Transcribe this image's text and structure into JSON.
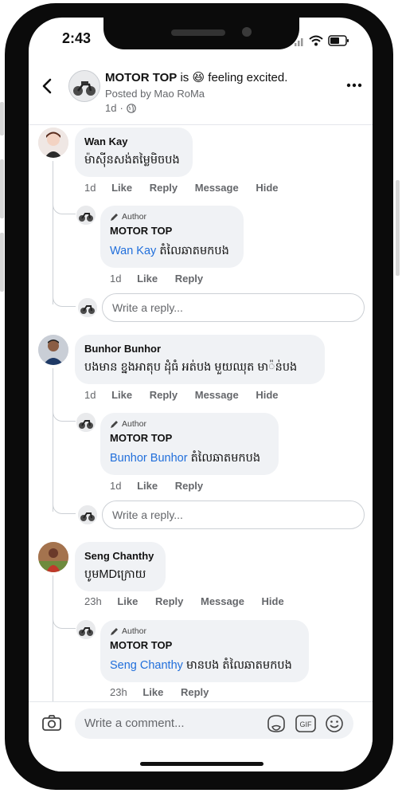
{
  "status_bar": {
    "time": "2:43"
  },
  "header": {
    "page_name": "MOTOR TOP",
    "status_prefix": "is",
    "status_emoji": "😆",
    "status_suffix": "feeling excited.",
    "posted_by": "Posted by Mao RoMa",
    "time": "1d"
  },
  "comments": [
    {
      "author": "Wan Kay",
      "text": "ម៉ាស៊ីនសង់តម្លៃមិចបង",
      "time": "1d",
      "actions": [
        "Like",
        "Reply",
        "Message",
        "Hide"
      ],
      "reply": {
        "badge": "Author",
        "author": "MOTOR TOP",
        "mention": "Wan Kay",
        "text": "តំលៃឆាតមកបង",
        "time": "1d",
        "actions": [
          "Like",
          "Reply"
        ]
      },
      "reply_placeholder": "Write a reply..."
    },
    {
      "author": "Bunhor Bunhor",
      "text": "បងមាន ខ្នងអាតុប ដំុធំ អត់បង មួយឈុត   មា៉ន់បង",
      "time": "1d",
      "actions": [
        "Like",
        "Reply",
        "Message",
        "Hide"
      ],
      "reply": {
        "badge": "Author",
        "author": "MOTOR TOP",
        "mention": "Bunhor Bunhor",
        "text": "តំលៃឆាតមកបង",
        "time": "1d",
        "actions": [
          "Like",
          "Reply"
        ]
      },
      "reply_placeholder": "Write a reply..."
    },
    {
      "author": "Seng Chanthy",
      "text": "បូមMDក្រោយ",
      "time": "23h",
      "actions": [
        "Like",
        "Reply",
        "Message",
        "Hide"
      ],
      "reply": {
        "badge": "Author",
        "author": "MOTOR TOP",
        "mention": "Seng Chanthy",
        "text": "មានបង តំលៃឆាតមកបង",
        "time": "23h",
        "actions": [
          "Like",
          "Reply"
        ]
      }
    }
  ],
  "composer": {
    "placeholder": "Write a comment...",
    "gif_label": "GIF"
  },
  "colors": {
    "link": "#216fdb",
    "bubble": "#f0f2f5",
    "secondary": "#65676b"
  }
}
